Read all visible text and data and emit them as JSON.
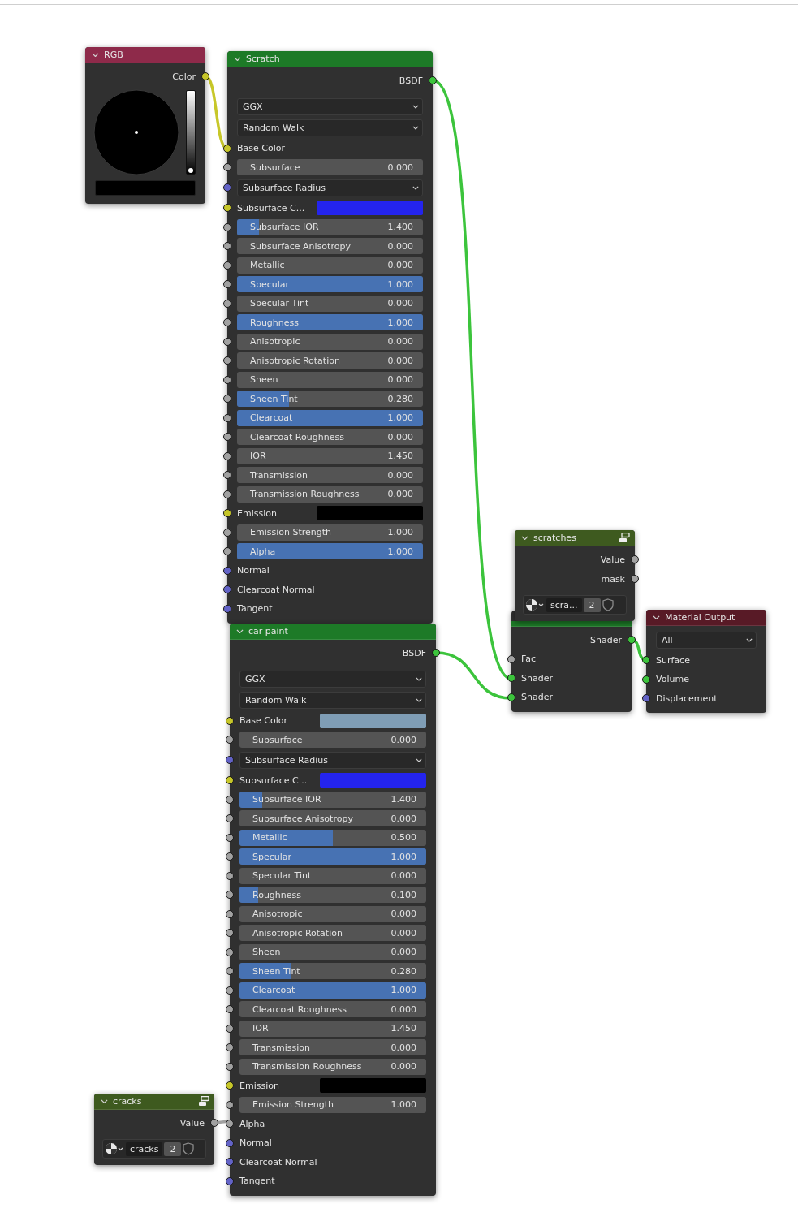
{
  "nodes": [
    {
      "kind": "rgb",
      "title": "RGB",
      "color": "#8e2a4a",
      "rows": [
        {
          "kind": "output",
          "label": "Color",
          "color": "#c7c729"
        },
        {
          "kind": "picker",
          "level": 0,
          "swatch": {
            "color": "#000000"
          }
        }
      ]
    },
    {
      "kind": "bsdf",
      "title": "Scratch",
      "color": "#1d7a27",
      "rows": [
        {
          "kind": "output",
          "label": "BSDF",
          "color": "#3cc43c"
        },
        {
          "kind": "dropdown",
          "label": "GGX"
        },
        {
          "kind": "dropdown",
          "label": "Random Walk"
        },
        {
          "kind": "input",
          "label": "Base Color",
          "color": "#c7c729"
        },
        {
          "kind": "slider",
          "label": "Subsurface",
          "value": "0.000",
          "color": "#a1a1a1"
        },
        {
          "kind": "dropdown",
          "label": "Subsurface Radius",
          "color": "#6363c7"
        },
        {
          "kind": "swatch",
          "label": "Subsurface C...",
          "color": "#c7c729",
          "swatch": {
            "color": "#2424ee"
          }
        },
        {
          "kind": "slider",
          "label": "Subsurface IOR",
          "value": "1.400",
          "level": 0.12,
          "color": "#a1a1a1"
        },
        {
          "kind": "slider",
          "label": "Subsurface Anisotropy",
          "value": "0.000",
          "color": "#a1a1a1"
        },
        {
          "kind": "slider",
          "label": "Metallic",
          "value": "0.000",
          "color": "#a1a1a1"
        },
        {
          "kind": "slider",
          "label": "Specular",
          "value": "1.000",
          "level": 1,
          "color": "#a1a1a1"
        },
        {
          "kind": "slider",
          "label": "Specular Tint",
          "value": "0.000",
          "color": "#a1a1a1"
        },
        {
          "kind": "slider",
          "label": "Roughness",
          "value": "1.000",
          "level": 1,
          "color": "#a1a1a1"
        },
        {
          "kind": "slider",
          "label": "Anisotropic",
          "value": "0.000",
          "color": "#a1a1a1"
        },
        {
          "kind": "slider",
          "label": "Anisotropic Rotation",
          "value": "0.000",
          "color": "#a1a1a1"
        },
        {
          "kind": "slider",
          "label": "Sheen",
          "value": "0.000",
          "color": "#a1a1a1"
        },
        {
          "kind": "slider",
          "label": "Sheen Tint",
          "value": "0.280",
          "level": 0.28,
          "color": "#a1a1a1"
        },
        {
          "kind": "slider",
          "label": "Clearcoat",
          "value": "1.000",
          "level": 1,
          "color": "#a1a1a1"
        },
        {
          "kind": "slider",
          "label": "Clearcoat Roughness",
          "value": "0.000",
          "color": "#a1a1a1"
        },
        {
          "kind": "slider",
          "label": "IOR",
          "value": "1.450",
          "color": "#a1a1a1"
        },
        {
          "kind": "slider",
          "label": "Transmission",
          "value": "0.000",
          "color": "#a1a1a1"
        },
        {
          "kind": "slider",
          "label": "Transmission Roughness",
          "value": "0.000",
          "color": "#a1a1a1"
        },
        {
          "kind": "swatch",
          "label": "Emission",
          "color": "#c7c729",
          "swatch": {
            "color": "#000000"
          }
        },
        {
          "kind": "slider",
          "label": "Emission Strength",
          "value": "1.000",
          "color": "#a1a1a1"
        },
        {
          "kind": "slider",
          "label": "Alpha",
          "value": "1.000",
          "level": 1,
          "color": "#a1a1a1"
        },
        {
          "kind": "input",
          "label": "Normal",
          "color": "#6363c7"
        },
        {
          "kind": "input",
          "label": "Clearcoat Normal",
          "color": "#6363c7"
        },
        {
          "kind": "input",
          "label": "Tangent",
          "color": "#6363c7"
        }
      ]
    },
    {
      "kind": "texture",
      "title": "scratches",
      "color": "#3e5a1f",
      "rows": [
        {
          "kind": "output",
          "label": "Value",
          "color": "#a1a1a1"
        },
        {
          "kind": "output",
          "label": "mask",
          "color": "#a1a1a1"
        },
        {
          "kind": "image",
          "name": "scra...",
          "users": "2"
        }
      ]
    },
    {
      "kind": "mix",
      "color": "#1d7a27",
      "rows": [
        {
          "kind": "output",
          "label": "Shader",
          "color": "#3cc43c"
        },
        {
          "kind": "input",
          "label": "Fac",
          "color": "#a1a1a1"
        },
        {
          "kind": "input",
          "label": "Shader",
          "color": "#3cc43c"
        },
        {
          "kind": "input",
          "label": "Shader",
          "color": "#3cc43c"
        }
      ]
    },
    {
      "kind": "output",
      "title": "Material Output",
      "color": "#581a26",
      "rows": [
        {
          "kind": "dropdown",
          "label": "All"
        },
        {
          "kind": "input",
          "label": "Surface",
          "color": "#3cc43c"
        },
        {
          "kind": "input",
          "label": "Volume",
          "color": "#3cc43c"
        },
        {
          "kind": "input",
          "label": "Displacement",
          "color": "#6363c7"
        }
      ]
    },
    {
      "kind": "bsdf",
      "title": "car paint",
      "color": "#1d7a27",
      "rows": [
        {
          "kind": "output",
          "label": "BSDF",
          "color": "#3cc43c"
        },
        {
          "kind": "dropdown",
          "label": "GGX"
        },
        {
          "kind": "dropdown",
          "label": "Random Walk"
        },
        {
          "kind": "swatch",
          "label": "Base Color",
          "color": "#c7c729",
          "swatch": {
            "color": "#7f9db5"
          }
        },
        {
          "kind": "slider",
          "label": "Subsurface",
          "value": "0.000",
          "color": "#a1a1a1"
        },
        {
          "kind": "dropdown",
          "label": "Subsurface Radius",
          "color": "#6363c7"
        },
        {
          "kind": "swatch",
          "label": "Subsurface C...",
          "color": "#c7c729",
          "swatch": {
            "color": "#2424ee"
          }
        },
        {
          "kind": "slider",
          "label": "Subsurface IOR",
          "value": "1.400",
          "level": 0.12,
          "color": "#a1a1a1"
        },
        {
          "kind": "slider",
          "label": "Subsurface Anisotropy",
          "value": "0.000",
          "color": "#a1a1a1"
        },
        {
          "kind": "slider",
          "label": "Metallic",
          "value": "0.500",
          "level": 0.5,
          "color": "#a1a1a1"
        },
        {
          "kind": "slider",
          "label": "Specular",
          "value": "1.000",
          "level": 1,
          "color": "#a1a1a1"
        },
        {
          "kind": "slider",
          "label": "Specular Tint",
          "value": "0.000",
          "color": "#a1a1a1"
        },
        {
          "kind": "slider",
          "label": "Roughness",
          "value": "0.100",
          "level": 0.1,
          "color": "#a1a1a1"
        },
        {
          "kind": "slider",
          "label": "Anisotropic",
          "value": "0.000",
          "color": "#a1a1a1"
        },
        {
          "kind": "slider",
          "label": "Anisotropic Rotation",
          "value": "0.000",
          "color": "#a1a1a1"
        },
        {
          "kind": "slider",
          "label": "Sheen",
          "value": "0.000",
          "color": "#a1a1a1"
        },
        {
          "kind": "slider",
          "label": "Sheen Tint",
          "value": "0.280",
          "level": 0.28,
          "color": "#a1a1a1"
        },
        {
          "kind": "slider",
          "label": "Clearcoat",
          "value": "1.000",
          "level": 1,
          "color": "#a1a1a1"
        },
        {
          "kind": "slider",
          "label": "Clearcoat Roughness",
          "value": "0.000",
          "color": "#a1a1a1"
        },
        {
          "kind": "slider",
          "label": "IOR",
          "value": "1.450",
          "color": "#a1a1a1"
        },
        {
          "kind": "slider",
          "label": "Transmission",
          "value": "0.000",
          "color": "#a1a1a1"
        },
        {
          "kind": "slider",
          "label": "Transmission Roughness",
          "value": "0.000",
          "color": "#a1a1a1"
        },
        {
          "kind": "swatch",
          "label": "Emission",
          "color": "#c7c729",
          "swatch": {
            "color": "#000000"
          }
        },
        {
          "kind": "slider",
          "label": "Emission Strength",
          "value": "1.000",
          "color": "#a1a1a1"
        },
        {
          "kind": "input",
          "label": "Alpha",
          "color": "#a1a1a1"
        },
        {
          "kind": "input",
          "label": "Normal",
          "color": "#6363c7"
        },
        {
          "kind": "input",
          "label": "Clearcoat Normal",
          "color": "#6363c7"
        },
        {
          "kind": "input",
          "label": "Tangent",
          "color": "#6363c7"
        }
      ]
    },
    {
      "kind": "texture",
      "title": "cracks",
      "color": "#3e5a1f",
      "rows": [
        {
          "kind": "output",
          "label": "Value",
          "color": "#a1a1a1"
        },
        {
          "kind": "image",
          "name": "cracks",
          "users": "2"
        }
      ]
    }
  ]
}
